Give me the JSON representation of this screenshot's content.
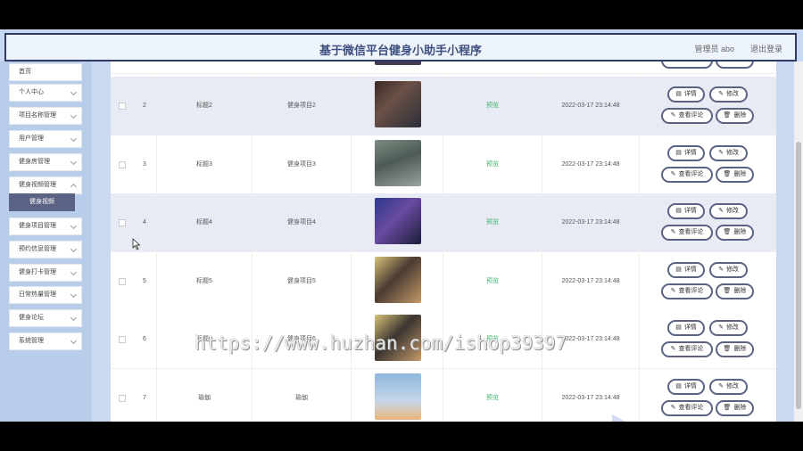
{
  "header": {
    "title": "基于微信平台健身小助手小程序",
    "user": "管理员 abo",
    "logout": "退出登录"
  },
  "sidebar": {
    "items": [
      {
        "label": "首页"
      },
      {
        "label": "个人中心"
      },
      {
        "label": "项目名称管理"
      },
      {
        "label": "用户管理"
      },
      {
        "label": "健身房管理"
      },
      {
        "label": "健身视频管理"
      },
      {
        "label": "健身视频",
        "active": true
      },
      {
        "label": "健身项目管理"
      },
      {
        "label": "预约信息管理"
      },
      {
        "label": "健身打卡管理"
      },
      {
        "label": "日常热量管理"
      },
      {
        "label": "健身论坛"
      },
      {
        "label": "系统管理"
      }
    ]
  },
  "buttons": {
    "detail": "详情",
    "edit": "修改",
    "comments": "查看评论",
    "delete": "删除"
  },
  "table": {
    "rows": [
      {
        "index": "2",
        "title": "标题2",
        "project": "健身项目2",
        "status": "预览",
        "time": "2022-03-17 23:14:48"
      },
      {
        "index": "3",
        "title": "标题3",
        "project": "健身项目3",
        "status": "预览",
        "time": "2022-03-17 23:14:48"
      },
      {
        "index": "4",
        "title": "标题4",
        "project": "健身项目4",
        "status": "预览",
        "time": "2022-03-17 23:14:48"
      },
      {
        "index": "5",
        "title": "标题5",
        "project": "健身项目5",
        "status": "预览",
        "time": "2022-03-17 23:14:48"
      },
      {
        "index": "6",
        "title": "标题6",
        "project": "健身项目6",
        "status": "预览",
        "time": "2022-03-17 23:14:48"
      },
      {
        "index": "7",
        "title": "瑜伽",
        "project": "瑜伽",
        "status": "预览",
        "time": "2022-03-17 23:14:48"
      }
    ]
  },
  "watermark": "https://www.huzhan.com/ishop39397",
  "colors": {
    "accent": "#5b6384",
    "status": "#3bb36b",
    "sidebar": "#b8cdea"
  }
}
